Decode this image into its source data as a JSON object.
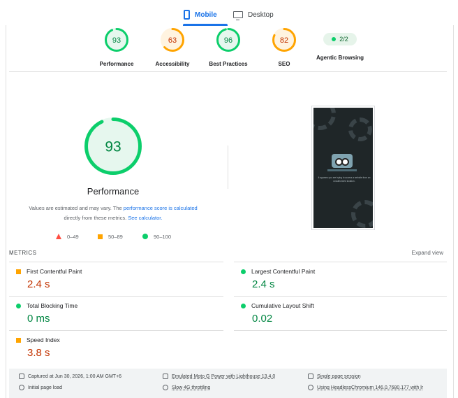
{
  "tabs": {
    "mobile": "Mobile",
    "desktop": "Desktop",
    "active": "mobile"
  },
  "categories": [
    {
      "score": "93",
      "label": "Performance",
      "value": 93,
      "color": "#0cce6b",
      "text_color": "#018642",
      "fill": "#e6f7ee"
    },
    {
      "score": "63",
      "label": "Accessibility",
      "value": 63,
      "color": "#ffa400",
      "text_color": "#c33300",
      "fill": "#fff3e0"
    },
    {
      "score": "96",
      "label": "Best Practices",
      "value": 96,
      "color": "#0cce6b",
      "text_color": "#018642",
      "fill": "#e6f7ee"
    },
    {
      "score": "82",
      "label": "SEO",
      "value": 82,
      "color": "#ffa400",
      "text_color": "#c33300",
      "fill": "#fff3e0"
    }
  ],
  "agentic": {
    "value": "2/2",
    "label": "Agentic Browsing"
  },
  "performance": {
    "score": "93",
    "value": 93,
    "title": "Performance",
    "note_pre": "Values are estimated and may vary. The ",
    "note_link1": "performance score is calculated",
    "note_mid": " directly from these metrics. ",
    "note_link2": "See calculator."
  },
  "legend": {
    "fail": "0–49",
    "average": "50–89",
    "pass": "90–100"
  },
  "screenshot": {
    "caption": "It appears you are trying to access a website from an unauthorized location."
  },
  "metrics": {
    "title": "METRICS",
    "expand": "Expand view",
    "items": [
      {
        "name": "First Contentful Paint",
        "value": "2.4 s",
        "status": "average"
      },
      {
        "name": "Largest Contentful Paint",
        "value": "2.4 s",
        "status": "pass"
      },
      {
        "name": "Total Blocking Time",
        "value": "0 ms",
        "status": "pass"
      },
      {
        "name": "Cumulative Layout Shift",
        "value": "0.02",
        "status": "pass"
      },
      {
        "name": "Speed Index",
        "value": "3.8 s",
        "status": "average"
      }
    ]
  },
  "footer": {
    "captured": "Captured at Jun 30, 2026, 1:00 AM GMT+6",
    "device": "Emulated Moto G Power with Lighthouse 13.4.0",
    "session": "Single page session",
    "load": "Initial page load",
    "throttling": "Slow 4G throttling",
    "browser": "Using HeadlessChromium 146.0.7680.177 with lr"
  }
}
